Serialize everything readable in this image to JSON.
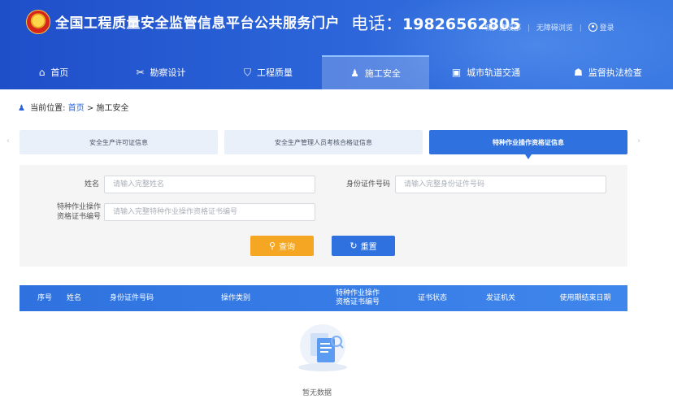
{
  "header": {
    "site_title": "全国工程质量安全监管信息平台公共服务门户",
    "phone_label": "电话：",
    "phone_number": "19826562805",
    "link_ministry": "城乡建设部",
    "link_accessible": "无障碍浏览",
    "link_login": "登录"
  },
  "nav": {
    "items": [
      {
        "label": "首页",
        "icon": "home-icon"
      },
      {
        "label": "勘察设计",
        "icon": "tools-icon"
      },
      {
        "label": "工程质量",
        "icon": "shield-icon"
      },
      {
        "label": "施工安全",
        "icon": "worker-icon"
      },
      {
        "label": "城市轨道交通",
        "icon": "train-icon"
      },
      {
        "label": "监督执法检查",
        "icon": "officer-icon"
      }
    ],
    "active_index": 3
  },
  "breadcrumb": {
    "prefix": "当前位置:",
    "home": "首页",
    "separator": ">",
    "current": "施工安全"
  },
  "tabs": [
    {
      "label": "安全生产许可证信息"
    },
    {
      "label": "安全生产管理人员考核合格证信息"
    },
    {
      "label": "特种作业操作资格证信息"
    }
  ],
  "form": {
    "name_label": "姓名",
    "name_placeholder": "请输入完整姓名",
    "id_label": "身份证件号码",
    "id_placeholder": "请输入完整身份证件号码",
    "cert_label_line1": "特种作业操作",
    "cert_label_line2": "资格证书编号",
    "cert_placeholder": "请输入完整特种作业操作资格证书编号",
    "query_label": "查询",
    "reset_label": "重置"
  },
  "table": {
    "columns": [
      "序号",
      "姓名",
      "身份证件号码",
      "操作类别",
      "特种作业操作",
      "资格证书编号",
      "证书状态",
      "发证机关",
      "使用期结束日期"
    ],
    "empty_text": "暂无数据"
  },
  "colors": {
    "primary": "#2f72df",
    "query_button": "#f5a623",
    "header_bg": "#2a63d8"
  }
}
